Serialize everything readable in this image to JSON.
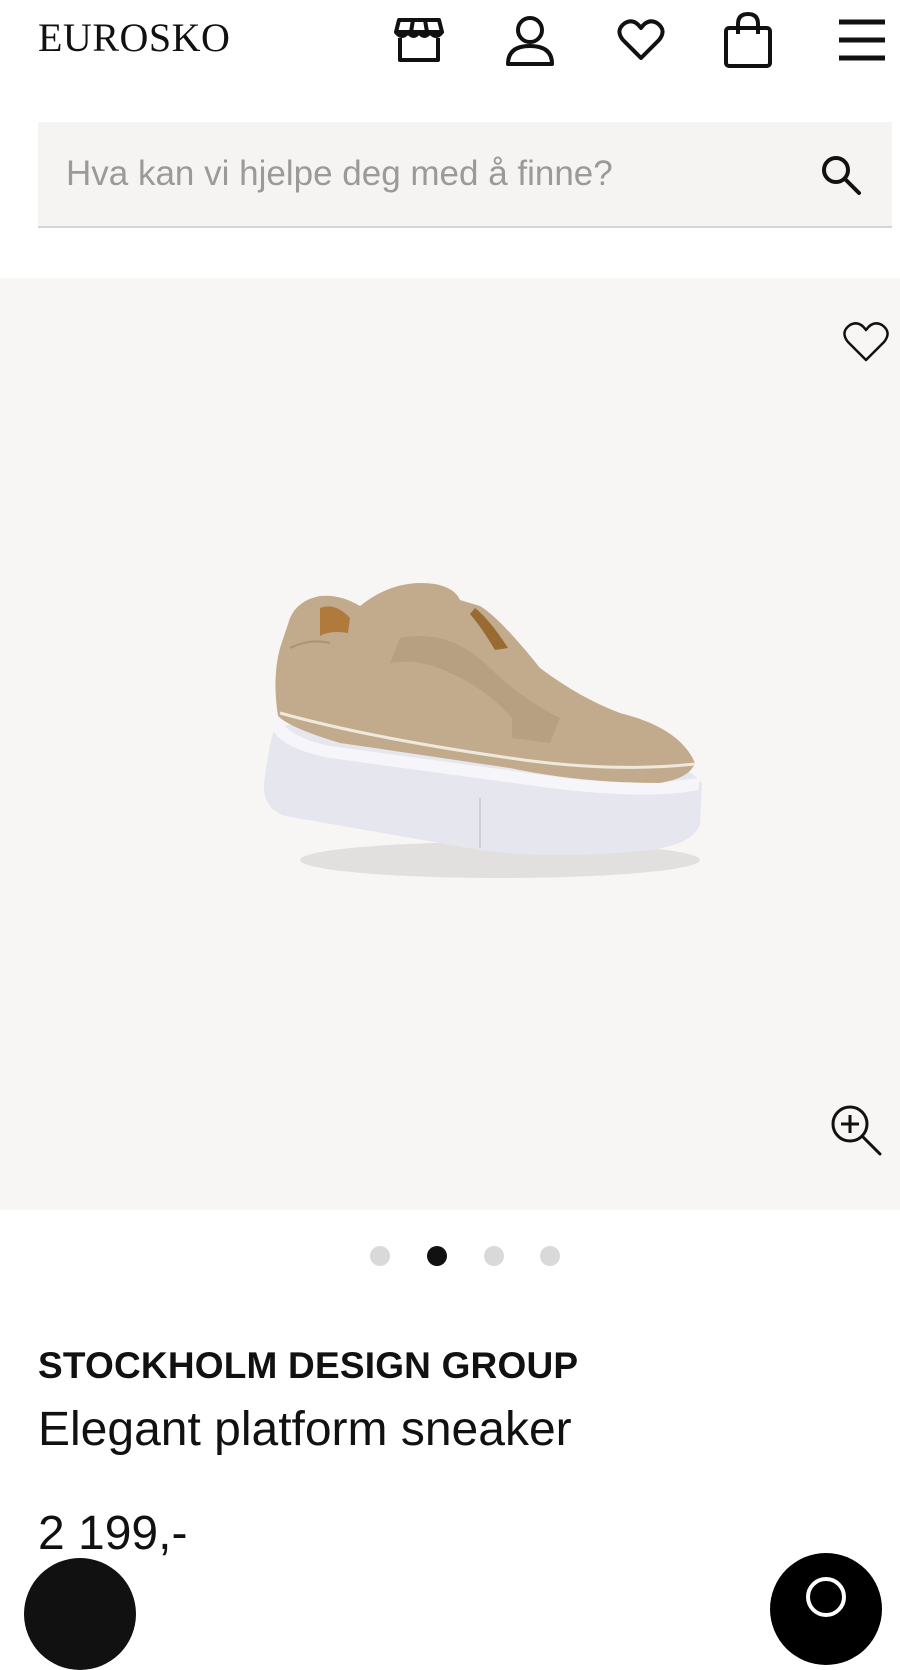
{
  "header": {
    "logo": "EUROSKO",
    "icons": [
      "store-icon",
      "user-icon",
      "heart-icon",
      "bag-icon",
      "menu-icon"
    ]
  },
  "search": {
    "placeholder": "Hva kan vi hjelpe deg med å finne?",
    "value": "",
    "icon": "search-icon"
  },
  "gallery": {
    "image_count": 4,
    "active_index": 1,
    "favorite_icon": "heart-icon",
    "zoom_icon": "zoom-in-icon"
  },
  "product": {
    "brand": "STOCKHOLM DESIGN GROUP",
    "name": "Elegant platform sneaker",
    "price": "2 199,-"
  },
  "colors": {
    "text": "#111111",
    "search_bg": "#f5f4f3",
    "gallery_bg": "#f7f6f5",
    "dot_inactive": "#d9d9d9",
    "dot_active": "#111111"
  }
}
